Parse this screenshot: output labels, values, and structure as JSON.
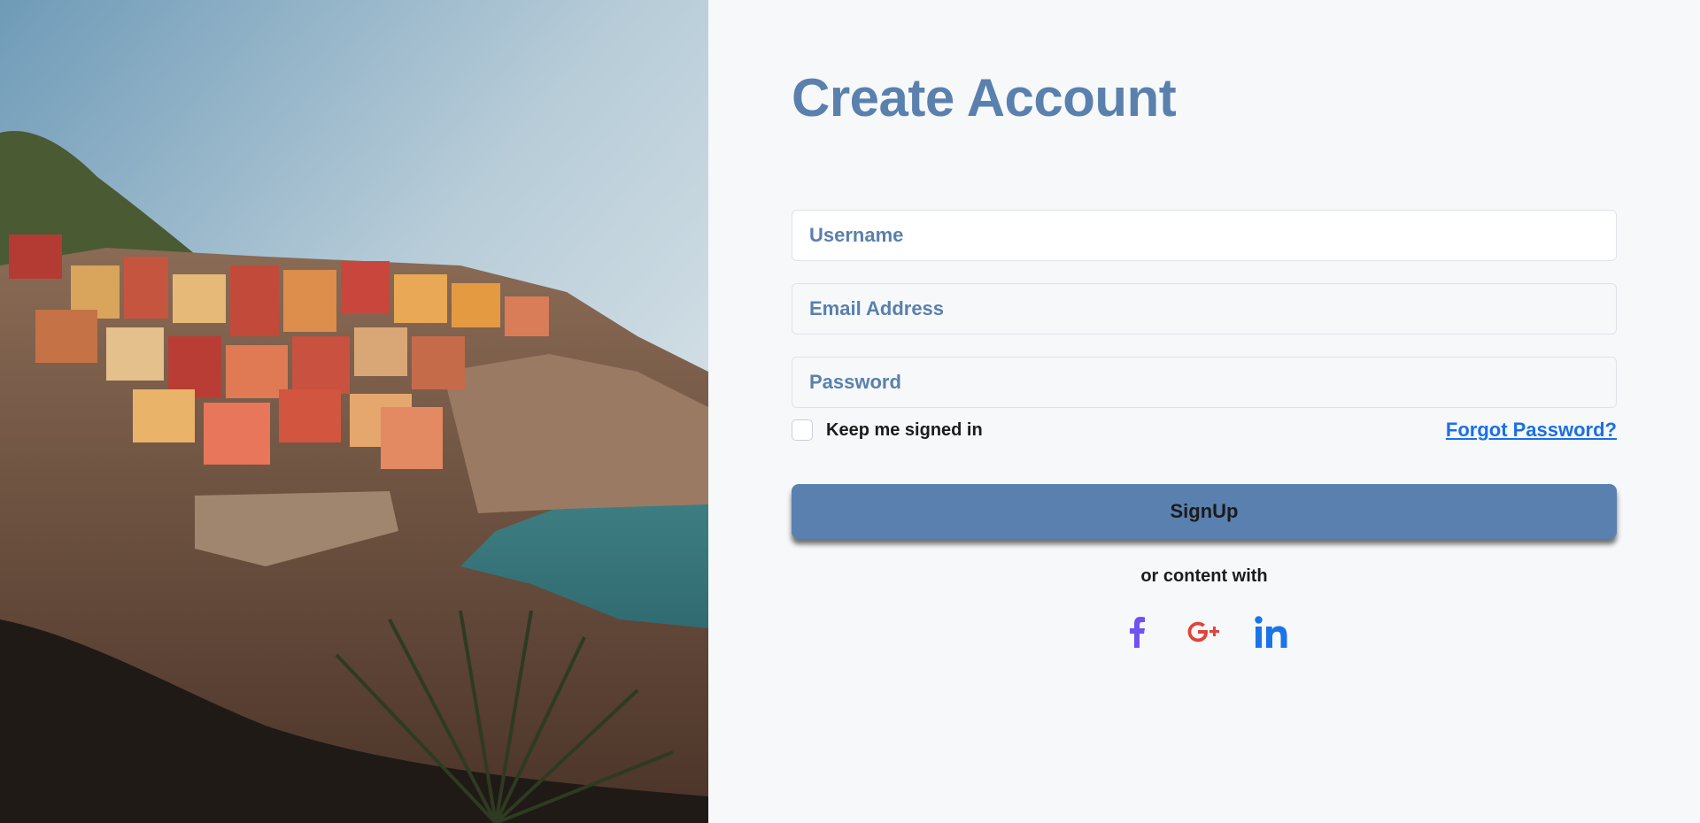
{
  "hero": {
    "image_alt": "coastal cliffside village",
    "icon": "landscape-photo"
  },
  "form": {
    "title": "Create Account",
    "username_placeholder": "Username",
    "email_placeholder": "Email Address",
    "password_placeholder": "Password",
    "remember_label": "Keep me signed in",
    "remember_checked": false,
    "forgot_label": "Forgot Password?",
    "signup_label": "SignUp",
    "or_text": "or content with"
  },
  "socials": [
    {
      "name": "facebook",
      "icon": "facebook-icon",
      "color": "#6f52f0"
    },
    {
      "name": "google-plus",
      "icon": "google-plus-icon",
      "color": "#e0433a"
    },
    {
      "name": "linkedin",
      "icon": "linkedin-icon",
      "color": "#1a74e8"
    }
  ],
  "colors": {
    "accent": "#5a80ad",
    "button": "#5a80b0",
    "link": "#1a6fe8",
    "background": "#f6f8fa"
  }
}
